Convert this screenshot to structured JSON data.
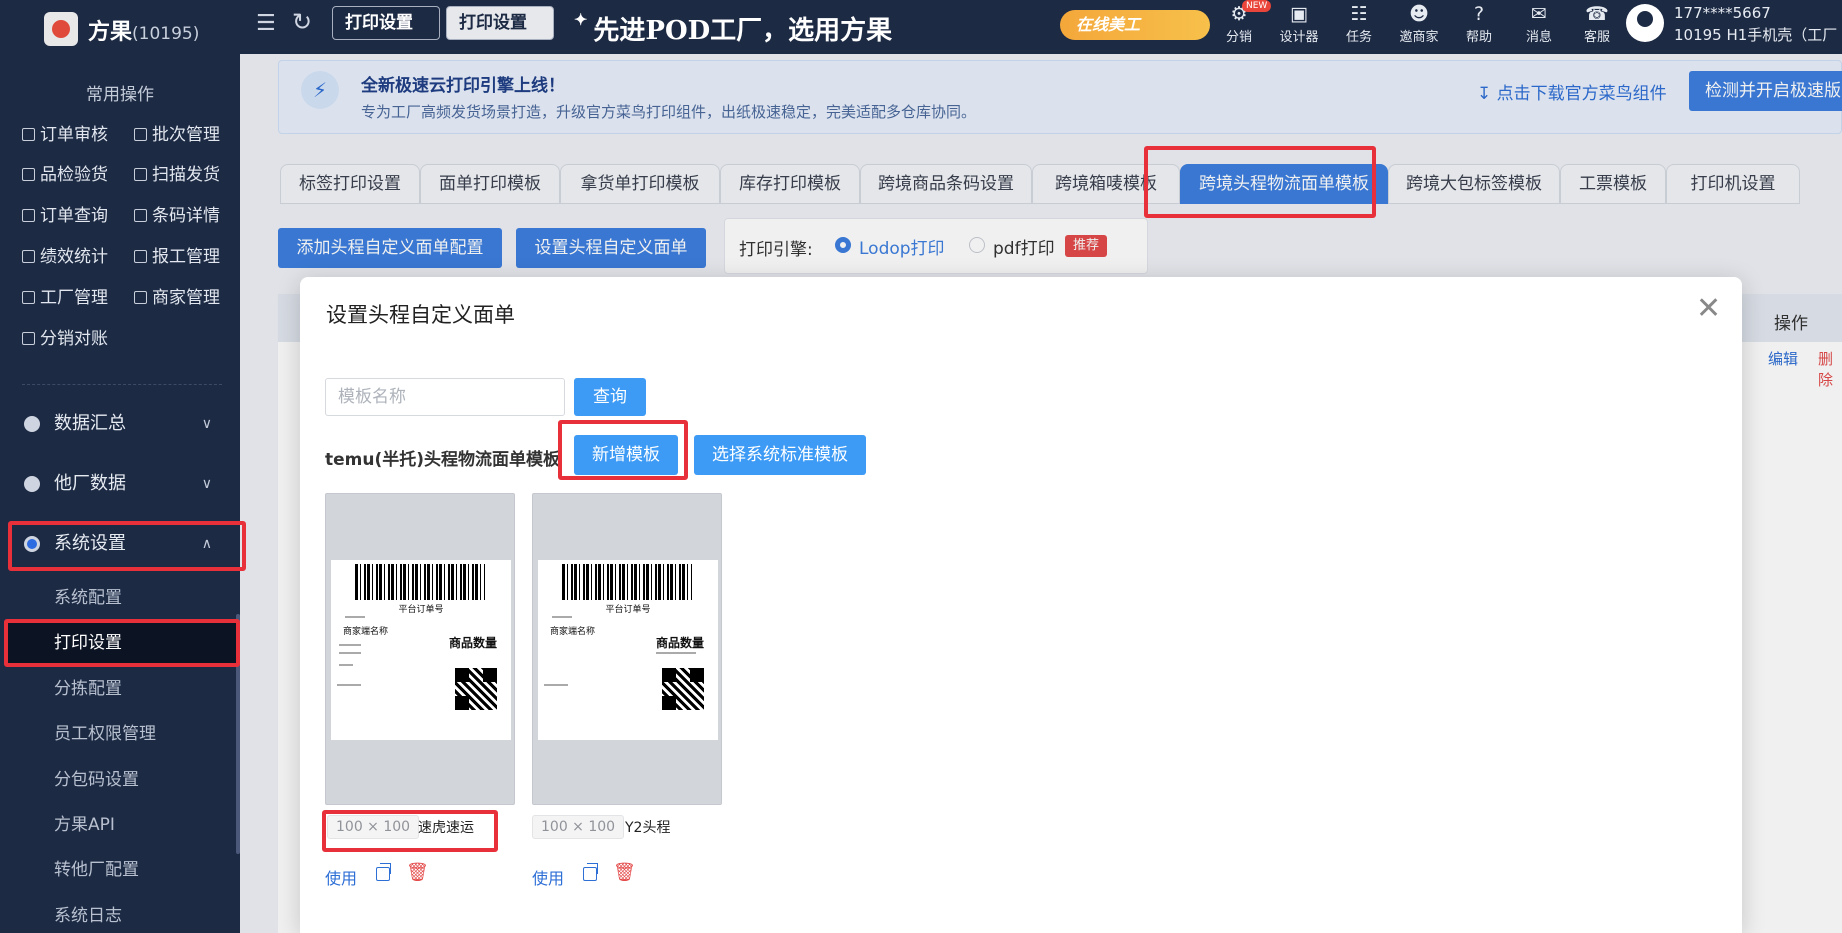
{
  "header": {
    "brand": "方果",
    "brand_count": "(10195)",
    "tab_print_1": "打印设置",
    "tab_print_2": "打印设置",
    "slogan": "先进POD工厂，选用方果",
    "promo": "在线美工",
    "tools": [
      {
        "label": "分销",
        "icon": "distribution-icon",
        "badge": "NEW"
      },
      {
        "label": "设计器",
        "icon": "designer-icon"
      },
      {
        "label": "任务",
        "icon": "task-icon"
      },
      {
        "label": "邀商家",
        "icon": "invite-icon"
      },
      {
        "label": "帮助",
        "icon": "help-icon"
      },
      {
        "label": "消息",
        "icon": "message-icon"
      },
      {
        "label": "客服",
        "icon": "service-icon"
      }
    ],
    "user_phone": "177****5667",
    "user_shop": "10195 H1手机壳（工厂"
  },
  "sidebar": {
    "section_title": "常用操作",
    "quick": [
      "订单审核",
      "批次管理",
      "品检验货",
      "扫描发货",
      "订单查询",
      "条码详情",
      "绩效统计",
      "报工管理",
      "工厂管理",
      "商家管理",
      "分销对账"
    ],
    "groups": [
      {
        "label": "数据汇总"
      },
      {
        "label": "他厂数据"
      },
      {
        "label": "系统设置"
      }
    ],
    "items": [
      "系统配置",
      "打印设置",
      "分拣配置",
      "员工权限管理",
      "分包码设置",
      "方果API",
      "转他厂配置",
      "系统日志"
    ]
  },
  "notice": {
    "title": "全新极速云打印引擎上线！",
    "desc": "专为工厂高频发货场景打造，升级官方菜鸟打印组件，出纸极速稳定，完美适配多仓库协同。",
    "download": "点击下载官方菜鸟组件",
    "detect_btn": "检测并开启极速版"
  },
  "tabs": [
    "标签打印设置",
    "面单打印模板",
    "拿货单打印模板",
    "库存打印模板",
    "跨境商品条码设置",
    "跨境箱唛模板",
    "跨境头程物流面单模板",
    "跨境大包标签模板",
    "工票模板",
    "打印机设置"
  ],
  "actions": {
    "add_config": "添加头程自定义面单配置",
    "set_custom": "设置头程自定义面单"
  },
  "engine": {
    "label": "打印引擎:",
    "lodop": "Lodop打印",
    "pdf": "pdf打印",
    "recommend": "推荐"
  },
  "table": {
    "op_header": "操作",
    "edit": "编辑",
    "delete": "删除"
  },
  "modal": {
    "title": "设置头程自定义面单",
    "search_placeholder": "模板名称",
    "query_btn": "查询",
    "section": "temu(半托)头程物流面单模板",
    "add_btn": "新增模板",
    "sys_btn": "选择系统标准模板",
    "templates": [
      {
        "size": "100 × 100",
        "name": "速虎速运",
        "use": "使用"
      },
      {
        "size": "100 × 100",
        "name": "Y2头程",
        "use": "使用"
      }
    ],
    "label_preview": {
      "order_no": "平台订单号",
      "merchant": "商家端名称",
      "qty": "商品数量"
    }
  },
  "colors": {
    "sidebar_bg": "#1c2a44",
    "primary": "#3d7fe0",
    "highlight": "#e8303a"
  }
}
